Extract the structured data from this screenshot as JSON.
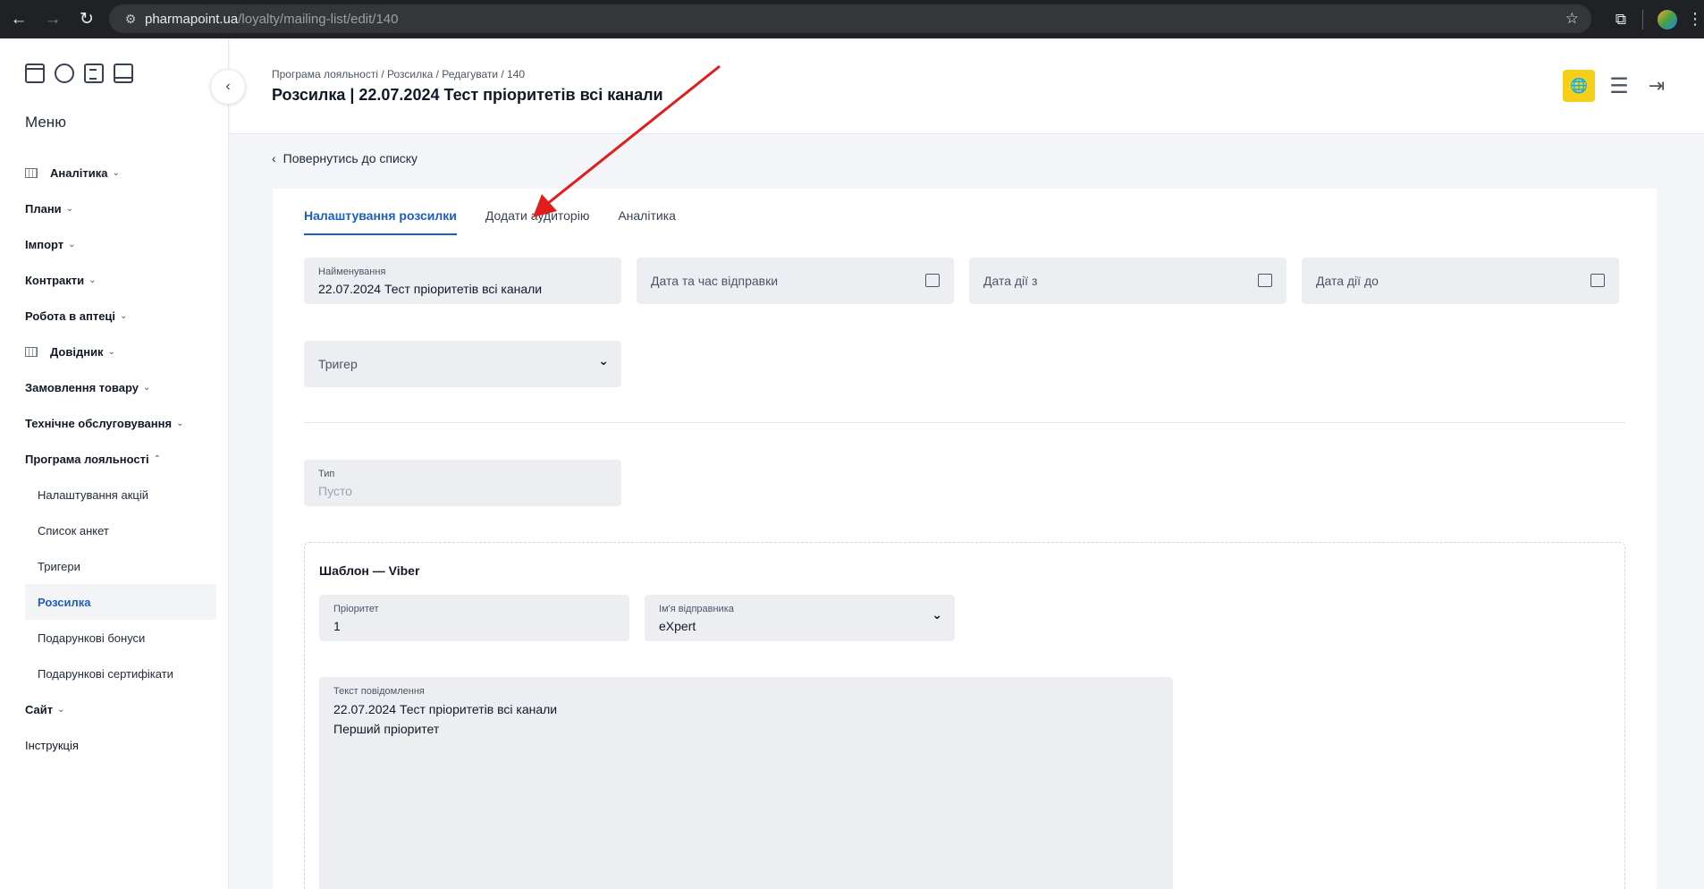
{
  "browser": {
    "url_host": "pharmapoint.ua",
    "url_path": "/loyalty/mailing-list/edit/140"
  },
  "sidebar": {
    "menu_title": "Меню",
    "items": [
      {
        "label": "Аналітика",
        "has_icon": true
      },
      {
        "label": "Плани"
      },
      {
        "label": "Імпорт"
      },
      {
        "label": "Контракти"
      },
      {
        "label": "Робота в аптеці"
      },
      {
        "label": "Довідник",
        "has_icon": true
      },
      {
        "label": "Замовлення товару"
      },
      {
        "label": "Технічне обслуговування"
      },
      {
        "label": "Програма лояльності"
      }
    ],
    "subitems": [
      {
        "label": "Налаштування акцій"
      },
      {
        "label": "Список анкет"
      },
      {
        "label": "Тригери"
      },
      {
        "label": "Розсилка",
        "active": true
      },
      {
        "label": "Подарункові бонуси"
      },
      {
        "label": "Подарункові сертифікати"
      }
    ],
    "after": [
      {
        "label": "Сайт"
      },
      {
        "label": "Інструкція"
      }
    ]
  },
  "header": {
    "breadcrumb": "Програма лояльності / Розсилка / Редагувати / 140",
    "title": "Розсилка | 22.07.2024 Тест пріоритетів всі канали"
  },
  "back_link": "Повернутись до списку",
  "tabs": [
    {
      "label": "Налаштування розсилки",
      "active": true
    },
    {
      "label": "Додати аудиторію"
    },
    {
      "label": "Аналітика"
    }
  ],
  "form": {
    "name_label": "Найменування",
    "name_value": "22.07.2024 Тест пріоритетів всі канали",
    "send_date_placeholder": "Дата та час відправки",
    "valid_from_placeholder": "Дата дії з",
    "valid_to_placeholder": "Дата дії до",
    "trigger_placeholder": "Тригер",
    "type_label": "Тип",
    "type_value": "Пусто"
  },
  "template": {
    "title": "Шаблон — Viber",
    "priority_label": "Пріоритет",
    "priority_value": "1",
    "sender_label": "Ім'я відправника",
    "sender_value": "eXpert",
    "message_label": "Текст повідомлення",
    "message_line1": "22.07.2024 Тест пріоритетів всі канали",
    "message_line2": "Перший пріоритет"
  },
  "accent_color": "#1d5fbf",
  "highlight_color": "#f5cf19",
  "annotation_color": "#e11d1d"
}
